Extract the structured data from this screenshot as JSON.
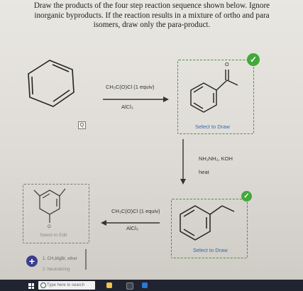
{
  "prompt": {
    "line1": "Draw the products of the four step reaction sequence shown below. Ignore",
    "line2": "inorganic byproducts. If the reaction results in a mixture of ortho and para",
    "line3": "isomers, draw only the para-product."
  },
  "steps": {
    "step1": {
      "reagent1": "CH₃C(O)Cl (1 equiv)",
      "reagent2": "AlCl₃"
    },
    "step2": {
      "reagent1": "NH₂NH₂, KOH",
      "reagent2": "heat"
    },
    "step3": {
      "reagent1": "CH₃C(O)Cl (1 equiv)",
      "reagent2": "AlCl₃"
    },
    "step4": {
      "reagent1": "1. CH₃MgBr, ether",
      "reagent2": "2. Neutralizing"
    }
  },
  "boxes": {
    "product1": {
      "select_label": "Select to Draw",
      "oxygen_label": "O",
      "status": "correct"
    },
    "product2": {
      "select_label": "Select to Draw",
      "status": "correct"
    },
    "product3": {
      "select_label": "Select to Edit",
      "oxygen_label": "O"
    }
  },
  "magnify_label": "Q",
  "add_button": "+",
  "taskbar": {
    "search_placeholder": "Type here to search"
  },
  "colors": {
    "correct": "#41a93a",
    "select_link": "#2b6cb0"
  }
}
